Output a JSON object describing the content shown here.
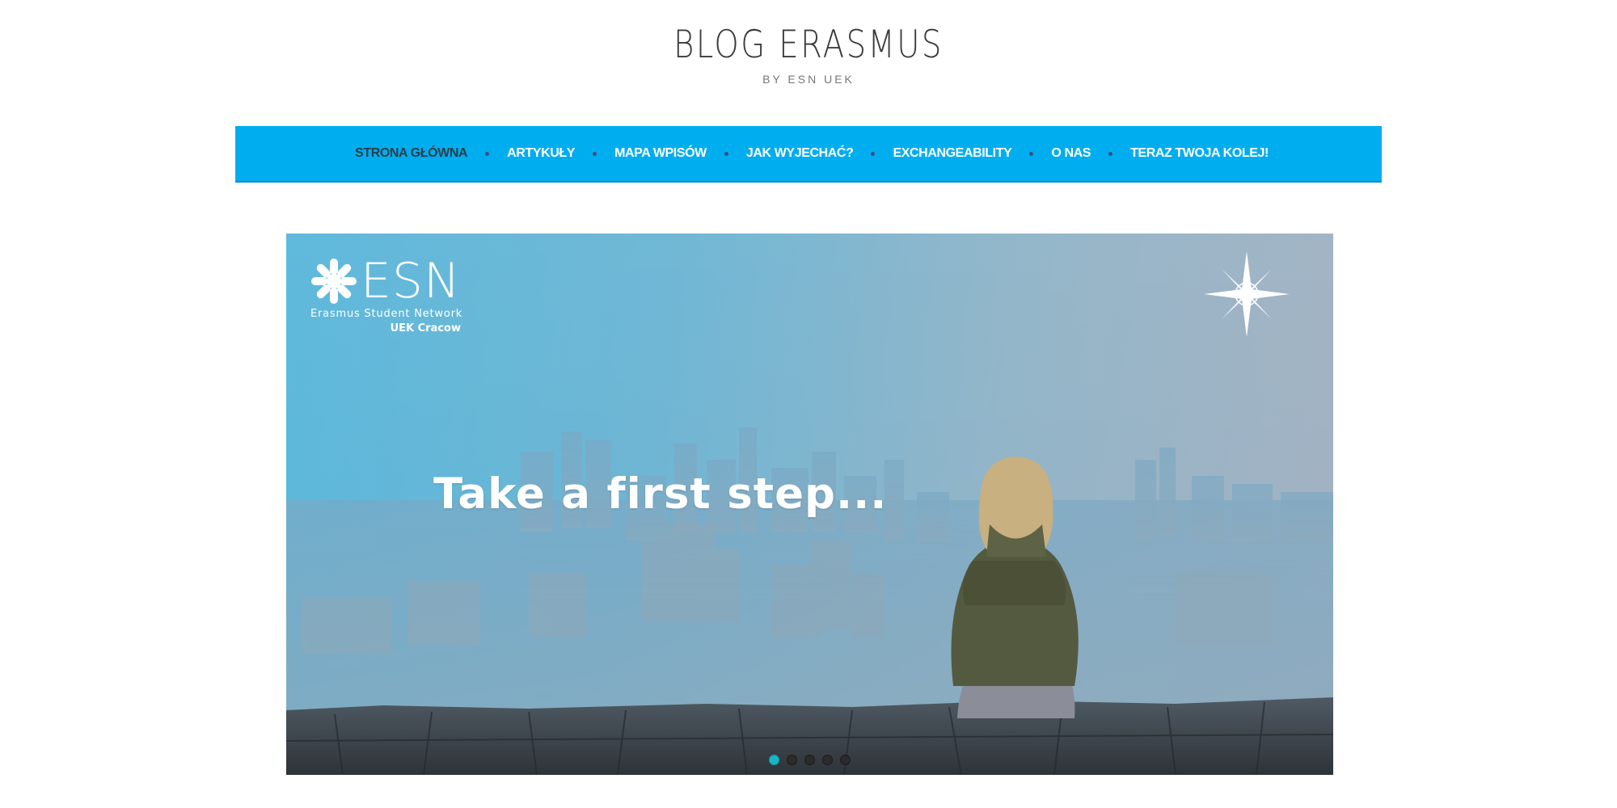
{
  "header": {
    "title": "BLOG ERASMUS",
    "tagline": "BY ESN UEK"
  },
  "nav": {
    "items": [
      {
        "label": "STRONA GŁÓWNA",
        "active": true
      },
      {
        "label": "ARTYKUŁY",
        "active": false
      },
      {
        "label": "MAPA WPISÓW",
        "active": false
      },
      {
        "label": "JAK WYJECHAĆ?",
        "active": false
      },
      {
        "label": "EXCHANGEABILITY",
        "active": false
      },
      {
        "label": "O NAS",
        "active": false
      },
      {
        "label": "TERAZ TWOJA KOLEJ!",
        "active": false
      }
    ],
    "active_color": "#2a3e4a",
    "background": "#00aeef"
  },
  "slider": {
    "caption": "Take a first step...",
    "logo": {
      "wordmark": "ESN",
      "line1": "Erasmus Student Network",
      "line2": "UEK Cracow"
    },
    "icons": [
      "esn-star-icon",
      "compass-rose-icon"
    ],
    "dots_count": 5,
    "active_dot": 1,
    "accent": "#17b6c9"
  }
}
